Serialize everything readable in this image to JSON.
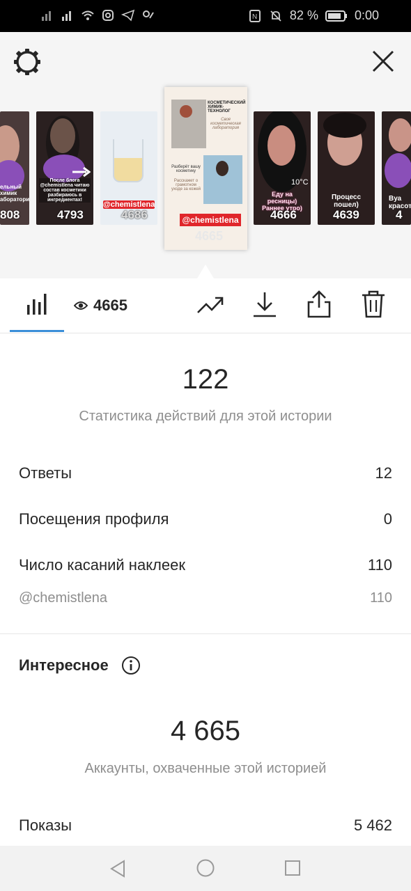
{
  "status_bar": {
    "battery_percent": "82 %",
    "time": "0:00"
  },
  "stories": [
    {
      "count": "808",
      "caption": "ельный химик\nаборатори"
    },
    {
      "count": "4793",
      "caption": "После блога @chemistlena читаю состав косметики разбираюсь в ингредиентах!"
    },
    {
      "count": "4686",
      "caption": "@chemistlena"
    },
    {
      "count": "4665",
      "caption": "@chemistlena",
      "selected": true,
      "title": "КОСМЕТИЧЕСКИЙ ХИМИК-ТЕХНОЛОГ",
      "script": "Своя косметическая лаборатория",
      "text1": "Разберёт вашу косметику",
      "text2": "Расскажет о грамотном уходе за кожей"
    },
    {
      "count": "4666",
      "caption": "Еду на ресницы) Раннее утро)",
      "temp": "10°C"
    },
    {
      "count": "4639",
      "caption": "Процесс пошел)"
    },
    {
      "count": "4",
      "caption": "Вуа красоти"
    }
  ],
  "tabs": {
    "views": "4665"
  },
  "actions": {
    "total": "122",
    "label": "Статистика действий для этой истории",
    "rows": [
      {
        "label": "Ответы",
        "value": "12"
      },
      {
        "label": "Посещения профиля",
        "value": "0"
      },
      {
        "label": "Число касаний наклеек",
        "value": "110"
      },
      {
        "label": "@chemistlena",
        "value": "110"
      }
    ]
  },
  "discovery": {
    "title": "Интересное",
    "reach": "4 665",
    "reach_label": "Аккаунты, охваченные этой историей",
    "rows": [
      {
        "label": "Показы",
        "value": "5 462"
      }
    ]
  }
}
